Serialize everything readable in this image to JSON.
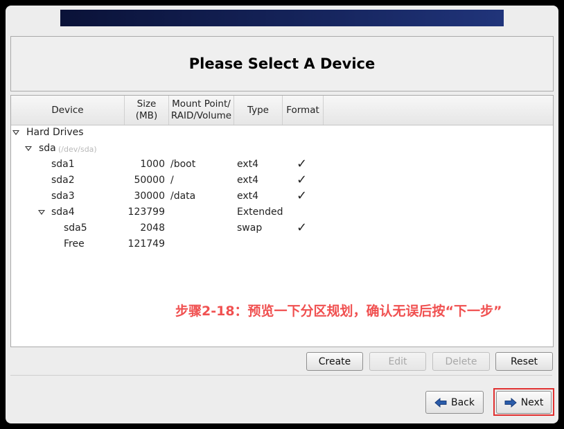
{
  "page": {
    "title": "Please Select A Device"
  },
  "table": {
    "columns": [
      {
        "line1": "Device",
        "line2": ""
      },
      {
        "line1": "Size",
        "line2": "(MB)"
      },
      {
        "line1": "Mount Point/",
        "line2": "RAID/Volume"
      },
      {
        "line1": "Type",
        "line2": ""
      },
      {
        "line1": "Format",
        "line2": ""
      }
    ],
    "group": "Hard Drives",
    "disk": {
      "name": "sda",
      "path": "(/dev/sda)"
    },
    "rows": [
      {
        "device": "sda1",
        "size": "1000",
        "mount": "/boot",
        "type": "ext4",
        "format": true
      },
      {
        "device": "sda2",
        "size": "50000",
        "mount": "/",
        "type": "ext4",
        "format": true
      },
      {
        "device": "sda3",
        "size": "30000",
        "mount": "/data",
        "type": "ext4",
        "format": true
      },
      {
        "device": "sda4",
        "size": "123799",
        "mount": "",
        "type": "Extended",
        "format": false
      },
      {
        "device": "sda5",
        "size": "2048",
        "mount": "",
        "type": "swap",
        "format": true
      },
      {
        "device": "Free",
        "size": "121749",
        "mount": "",
        "type": "",
        "format": false
      }
    ],
    "check_glyph": "✓"
  },
  "annotation": "步骤2-18：预览一下分区规划，确认无误后按“下一步”",
  "actions": {
    "create": "Create",
    "edit": "Edit",
    "delete": "Delete",
    "reset": "Reset"
  },
  "nav": {
    "back": "Back",
    "next": "Next"
  },
  "colors": {
    "annotation": "#f05050",
    "highlight": "#e03030",
    "arrow": "#2a5caa"
  }
}
